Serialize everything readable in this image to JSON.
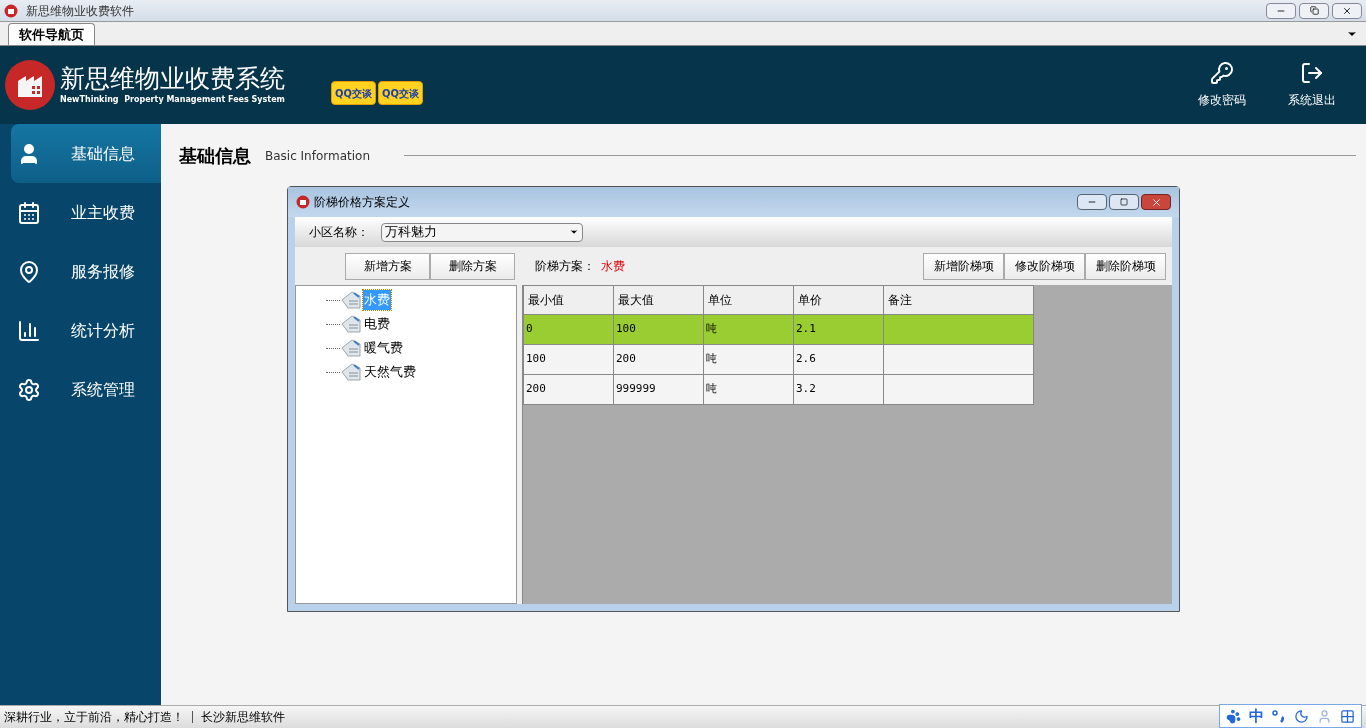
{
  "window": {
    "title": "新思维物业收费软件"
  },
  "tabs": [
    {
      "label": "软件导航页",
      "selected": true
    }
  ],
  "header": {
    "title": "新思维物业收费系统",
    "subtitle": "NewThinking  Property Management Fees System",
    "qq_buttons": [
      "QQ交谈",
      "QQ交谈"
    ],
    "actions": [
      {
        "label": "修改密码",
        "kind": "key"
      },
      {
        "label": "系统退出",
        "kind": "exit"
      }
    ]
  },
  "sidebar": {
    "items": [
      {
        "label": "基础信息",
        "kind": "user",
        "selected": true
      },
      {
        "label": "业主收费",
        "kind": "calendar",
        "selected": false
      },
      {
        "label": "服务报修",
        "kind": "pin",
        "selected": false
      },
      {
        "label": "统计分析",
        "kind": "chart",
        "selected": false
      },
      {
        "label": "系统管理",
        "kind": "gear",
        "selected": false
      }
    ]
  },
  "page": {
    "title": "基础信息",
    "subtitle": "Basic Information"
  },
  "dialog": {
    "title": "阶梯价格方案定义",
    "community_label": "小区名称：",
    "community_value": "万科魅力",
    "plan_buttons": [
      "新增方案",
      "删除方案"
    ],
    "plan_label": "阶梯方案：",
    "plan_value": "水费",
    "item_buttons": [
      "新增阶梯项",
      "修改阶梯项",
      "删除阶梯项"
    ],
    "tree": [
      {
        "label": "水费",
        "selected": true
      },
      {
        "label": "电费",
        "selected": false
      },
      {
        "label": "暖气费",
        "selected": false
      },
      {
        "label": "天然气费",
        "selected": false
      }
    ],
    "table": {
      "columns": [
        "最小值",
        "最大值",
        "单位",
        "单价",
        "备注"
      ],
      "rows": [
        {
          "cells": [
            "0",
            "100",
            "吨",
            "2.1"
          ],
          "selected": true
        },
        {
          "cells": [
            "100",
            "200",
            "吨",
            "2.6"
          ],
          "selected": false
        },
        {
          "cells": [
            "200",
            "999999",
            "吨",
            "3.2"
          ],
          "selected": false
        }
      ]
    }
  },
  "status_bar": {
    "texts": [
      "深耕行业，立于前沿，精心打造！",
      "长沙新思维软件"
    ]
  },
  "ime": {
    "label": "中"
  }
}
